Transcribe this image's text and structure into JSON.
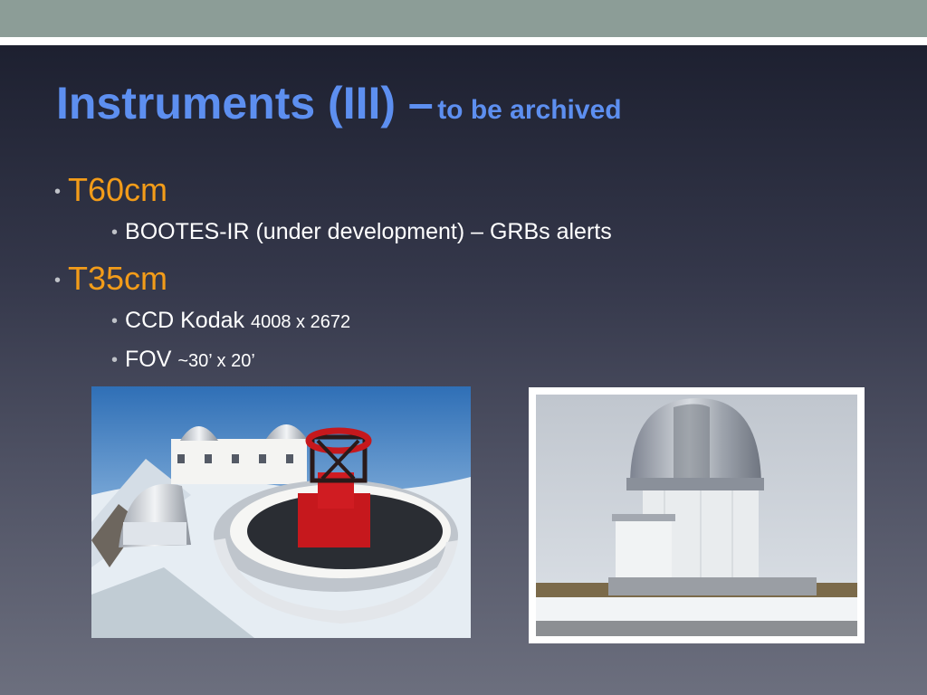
{
  "slide": {
    "title_main": "Instruments (III) –",
    "title_sub": "to be archived",
    "items": [
      {
        "label": "T60cm",
        "subitems": [
          {
            "text": "BOOTES-IR (under development) – GRBs alerts",
            "small": ""
          }
        ]
      },
      {
        "label": "T35cm",
        "subitems": [
          {
            "text": "CCD Kodak",
            "small": "4008 x 2672"
          },
          {
            "text": "FOV",
            "small": "~30’ x 20’"
          }
        ]
      }
    ],
    "photos": [
      {
        "subject": "telescope-dome-snow-photo"
      },
      {
        "subject": "small-observatory-dome-photo"
      }
    ],
    "colors": {
      "title": "#5d8ff0",
      "level1": "#f39c19",
      "level2": "#ffffff",
      "topbar": "#8c9d97"
    }
  }
}
